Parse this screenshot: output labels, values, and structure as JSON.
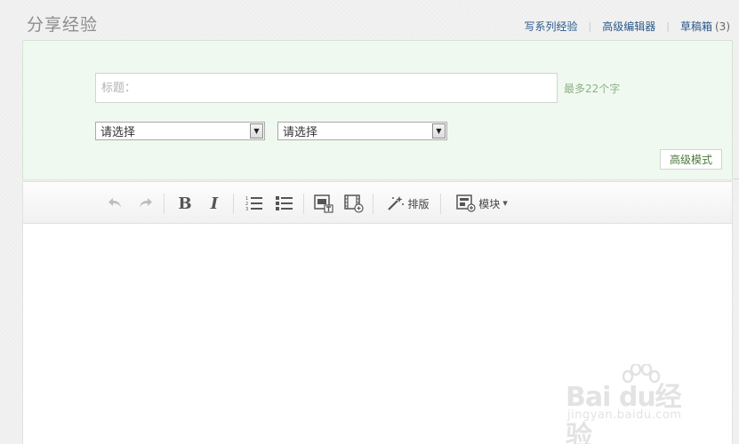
{
  "header": {
    "title": "分享经验",
    "links": [
      {
        "label": "写系列经验"
      },
      {
        "label": "高级编辑器"
      },
      {
        "label": "草稿箱"
      }
    ],
    "draft_count": "(3)"
  },
  "form": {
    "title_placeholder": "标题：",
    "title_value": "",
    "limit_hint": "最多22个字",
    "category_1": "请选择",
    "category_2": "请选择",
    "advanced_mode_label": "高级模式"
  },
  "toolbar": {
    "icons": [
      "undo-icon",
      "redo-icon",
      "bold-icon",
      "italic-icon",
      "ordered-list-icon",
      "unordered-list-icon",
      "insert-image-icon",
      "insert-video-icon",
      "magic-wand-icon",
      "module-icon"
    ],
    "bold_glyph": "B",
    "italic_glyph": "I",
    "format_label": "排版",
    "module_label": "模块"
  },
  "watermark": {
    "logo": "Bai du经验",
    "url": "jingyan.baidu.com"
  }
}
